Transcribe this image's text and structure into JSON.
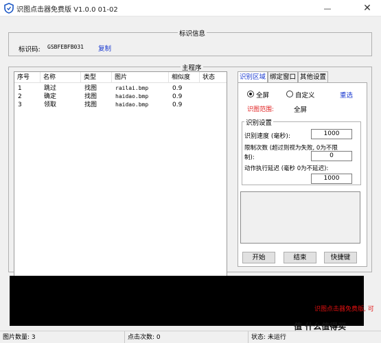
{
  "window": {
    "title": "识图点击器免费版 V1.0.0   01-02",
    "minimize_glyph": "—",
    "close_glyph": "✕",
    "icon": "shield-icon"
  },
  "id_group": {
    "title": "标识信息",
    "label": "标识码:",
    "value": "GSBFEBFB031",
    "copy": "复制"
  },
  "main_group": {
    "title": "主程序"
  },
  "list": {
    "columns": [
      "序号",
      "名称",
      "类型",
      "图片",
      "相似度",
      "状态"
    ],
    "rows": [
      [
        "1",
        "跳过",
        "找图",
        "railai.bmp",
        "0.9",
        ""
      ],
      [
        "2",
        "确定",
        "找图",
        "haidao.bmp",
        "0.9",
        ""
      ],
      [
        "3",
        "领取",
        "找图",
        "haidao.bmp",
        "0.9",
        ""
      ]
    ]
  },
  "tabs": [
    "识别区域",
    "绑定窗口",
    "其他设置"
  ],
  "area": {
    "fullscreen": "全屏",
    "custom": "自定义",
    "reselect": "重选",
    "range_label": "识图范围:",
    "range_value": "全屏"
  },
  "recog": {
    "title": "识别设置",
    "speed_label": "识别速度 (毫秒):",
    "speed_value": "1000",
    "limit_label_1": "限制次数 (超过则视为失败, 0为不限",
    "limit_label_2": "制):",
    "limit_value": "0",
    "delay_label": "动作执行延迟 (毫秒 0为不延迟):",
    "delay_value": "1000"
  },
  "buttons": {
    "start": "开始",
    "stop": "结束",
    "hotkey": "快捷键"
  },
  "console": {
    "ad_text": "识图点击器免费版, 可",
    "brand": "值 什么值得买"
  },
  "status": {
    "image_count": "图片数量: 3",
    "click_count": "点击次数: 0",
    "state": "状态:  未运行"
  }
}
